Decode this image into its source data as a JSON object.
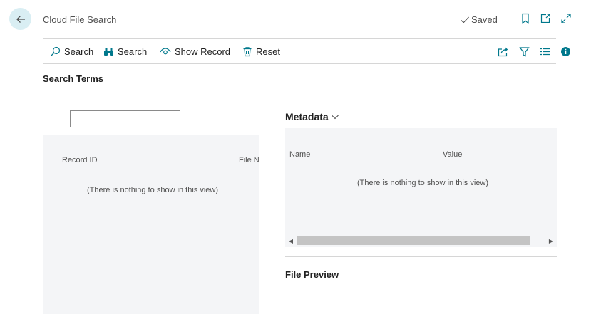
{
  "header": {
    "title": "Cloud File Search",
    "saved_label": "Saved",
    "icons": [
      "back-arrow-icon",
      "check-icon",
      "bookmark-icon",
      "open-new-window-icon",
      "expand-icon"
    ]
  },
  "actions": {
    "search_label": "Search",
    "find_label": "Search",
    "show_record_label": "Show Record",
    "reset_label": "Reset",
    "right_icons": [
      "share-icon",
      "filter-icon",
      "list-view-icon",
      "info-icon"
    ]
  },
  "search_section": {
    "title": "Search Terms",
    "input_value": "",
    "columns": [
      "Record ID",
      "File Na"
    ],
    "empty_message": "(There is nothing to show in this view)"
  },
  "metadata": {
    "title": "Metadata",
    "columns": [
      "Name",
      "Value"
    ],
    "empty_message": "(There is nothing to show in this view)"
  },
  "file_preview": {
    "title": "File Preview"
  },
  "colors": {
    "accent": "#00788c",
    "back_button_bg": "#d9eef3",
    "panel_bg": "#f4f5f7",
    "scroll_thumb": "#c4c4c4"
  }
}
